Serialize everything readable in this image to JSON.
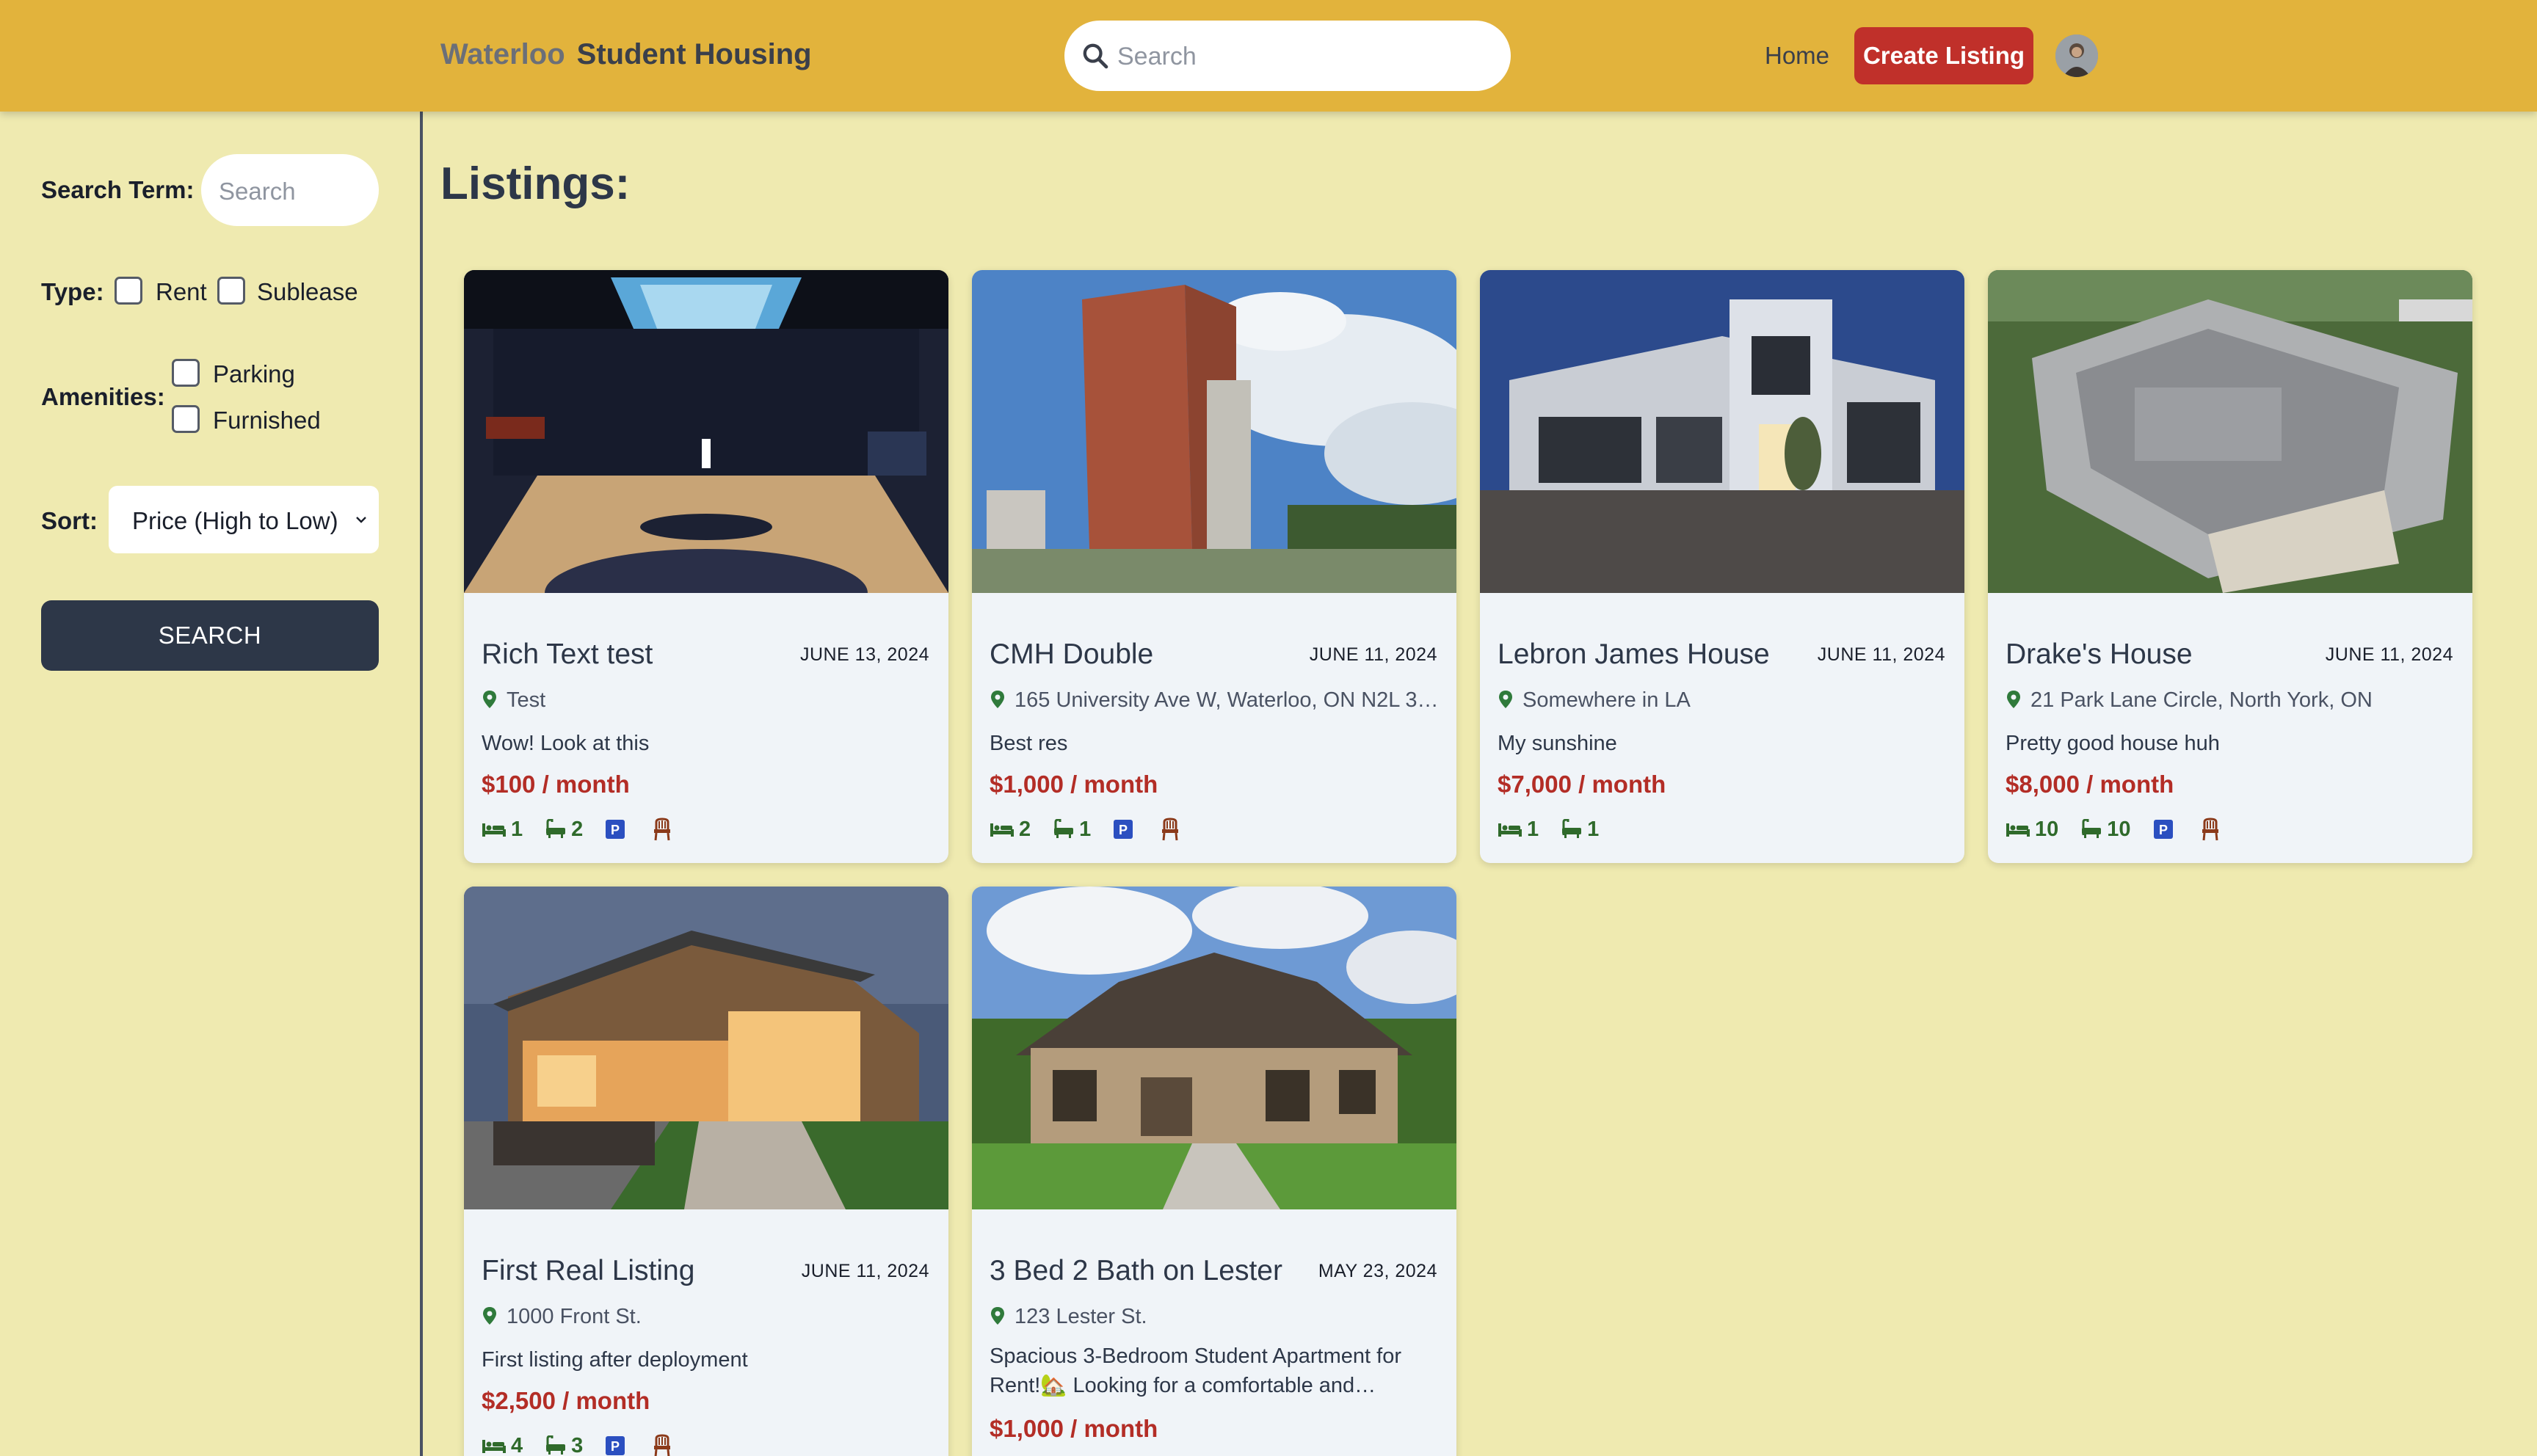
{
  "header": {
    "brand_part1": "Waterloo",
    "brand_part2": "Student Housing",
    "search_placeholder": "Search",
    "nav_home": "Home",
    "create_listing": "Create Listing"
  },
  "sidebar": {
    "search_term_label": "Search Term:",
    "search_placeholder": "Search",
    "type_label": "Type:",
    "type_options": [
      "Rent",
      "Sublease"
    ],
    "amenities_label": "Amenities:",
    "amenity_options": [
      "Parking",
      "Furnished"
    ],
    "sort_label": "Sort:",
    "sort_value": "Price (High to Low)",
    "search_button": "SEARCH"
  },
  "main": {
    "title": "Listings:",
    "listings": [
      {
        "title": "Rich Text test",
        "date": "JUNE 13, 2024",
        "address": "Test",
        "description": "Wow! Look at this",
        "price": "$100 / month",
        "beds": "1",
        "baths": "2",
        "parking": true,
        "furnished": true,
        "image": "gym"
      },
      {
        "title": "CMH Double",
        "date": "JUNE 11, 2024",
        "address": "165 University Ave W, Waterloo, ON N2L 3…",
        "description": "Best res",
        "price": "$1,000 / month",
        "beds": "2",
        "baths": "1",
        "parking": true,
        "furnished": true,
        "image": "tower"
      },
      {
        "title": "Lebron James House",
        "date": "JUNE 11, 2024",
        "address": "Somewhere in LA",
        "description": "My sunshine",
        "price": "$7,000 / month",
        "beds": "1",
        "baths": "1",
        "parking": false,
        "furnished": false,
        "image": "modern-white"
      },
      {
        "title": "Drake's House",
        "date": "JUNE 11, 2024",
        "address": "21 Park Lane Circle, North York, ON",
        "description": "Pretty good house huh",
        "price": "$8,000 / month",
        "beds": "10",
        "baths": "10",
        "parking": true,
        "furnished": true,
        "image": "mansion"
      },
      {
        "title": "First Real Listing",
        "date": "JUNE 11, 2024",
        "address": "1000 Front St.",
        "description": "First listing after deployment",
        "price": "$2,500 / month",
        "beds": "4",
        "baths": "3",
        "parking": true,
        "furnished": true,
        "image": "hillside"
      },
      {
        "title": "3 Bed 2 Bath on Lester",
        "date": "MAY 23, 2024",
        "address": "123 Lester St.",
        "description": "Spacious 3-Bedroom Student Apartment for Rent!🏡 Looking for a comfortable and…",
        "price": "$1,000 / month",
        "beds": "",
        "baths": "",
        "parking": false,
        "furnished": false,
        "image": "suburban"
      }
    ]
  },
  "colors": {
    "header_bg": "#e2b33c",
    "page_bg": "#efeab0",
    "accent_red": "#c0302a",
    "price_red": "#b32d26",
    "feature_green": "#2f6a2b",
    "parking_blue": "#2b4fc0",
    "furnished_brown": "#8b3a1a",
    "dark_button": "#2d3748"
  },
  "icons": {
    "search": "search-icon",
    "pin": "map-pin-icon",
    "bed": "bed-icon",
    "bath": "bath-icon",
    "parking": "parking-icon",
    "furnished": "chair-icon"
  }
}
